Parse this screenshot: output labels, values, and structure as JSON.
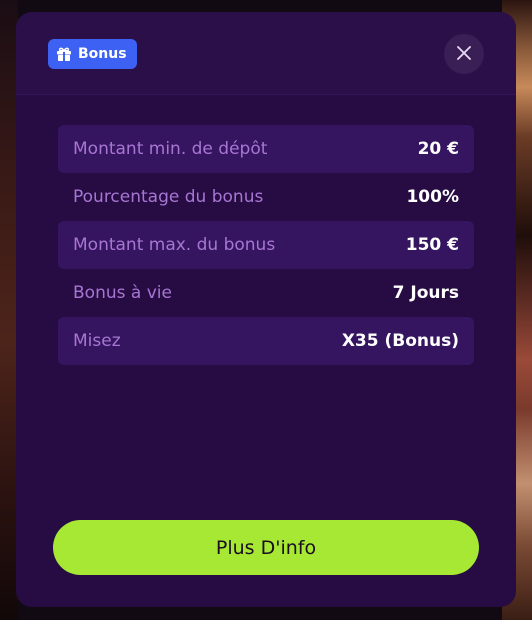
{
  "header": {
    "badge_label": "Bonus",
    "badge_icon": "gift-icon",
    "close_icon": "close-icon"
  },
  "details": {
    "rows": [
      {
        "label": "Montant min. de dépôt",
        "value": "20 €"
      },
      {
        "label": "Pourcentage du bonus",
        "value": "100%"
      },
      {
        "label": "Montant max. du bonus",
        "value": "150 €"
      },
      {
        "label": "Bonus à vie",
        "value": "7 Jours"
      },
      {
        "label": "Misez",
        "value": "X35 (Bonus)"
      }
    ]
  },
  "footer": {
    "cta_label": "Plus D'info"
  },
  "colors": {
    "modal_bg": "#260c42",
    "row_shaded_bg": "#361560",
    "label_text": "#a776d3",
    "badge_bg": "#3d61f2",
    "cta_bg": "#a6e834"
  }
}
